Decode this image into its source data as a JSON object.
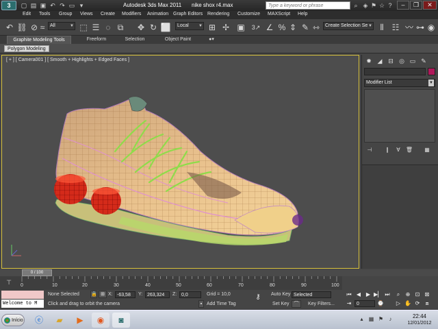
{
  "window": {
    "app_title": "Autodesk 3ds Max  2011",
    "file_name": "nike shox r4.max",
    "help_search_placeholder": "Type a keyword or phrase",
    "logo_text": "3"
  },
  "menu": [
    "Edit",
    "Tools",
    "Group",
    "Views",
    "Create",
    "Modifiers",
    "Animation",
    "Graph Editors",
    "Rendering",
    "Customize",
    "MAXScript",
    "Help"
  ],
  "toolbar": {
    "selection_filter": "All",
    "ref_coord": "Local",
    "named_selection": "Create Selection Se",
    "snap_label": "3"
  },
  "ribbon": {
    "tabs": [
      "Graphite Modeling Tools",
      "Freeform",
      "Selection",
      "Object Paint"
    ],
    "active_tab": "Graphite Modeling Tools",
    "panel_label": "Polygon Modeling"
  },
  "viewport": {
    "label": "[ + ] [ Camera001 ] [ Smooth + Highlights + Edged Faces ]",
    "border_color": "#d9c23c"
  },
  "command_panel": {
    "modifier_list": "Modifier List",
    "object_color": "#b0185a"
  },
  "timeline": {
    "frame_readout": "0 / 100",
    "ticks": [
      "0",
      "10",
      "20",
      "30",
      "40",
      "50",
      "60",
      "70",
      "80",
      "90",
      "100"
    ]
  },
  "status": {
    "maxscript_text": "Welcome to M",
    "selection": "None Selected",
    "prompt": "Click and drag to orbit the camera",
    "x_label": "X:",
    "x_value": "-63,58",
    "y_label": "Y:",
    "y_value": "263,324",
    "z_label": "Z:",
    "z_value": "0,0",
    "grid": "Grid = 10,0",
    "add_time_tag": "Add Time Tag",
    "auto_key": "Auto Key",
    "key_mode": "Selected",
    "set_key": "Set Key",
    "key_filters": "Key Filters...",
    "frame": "0"
  },
  "taskbar": {
    "start_label": "Início",
    "time": "22:44",
    "date": "12/01/2012"
  }
}
